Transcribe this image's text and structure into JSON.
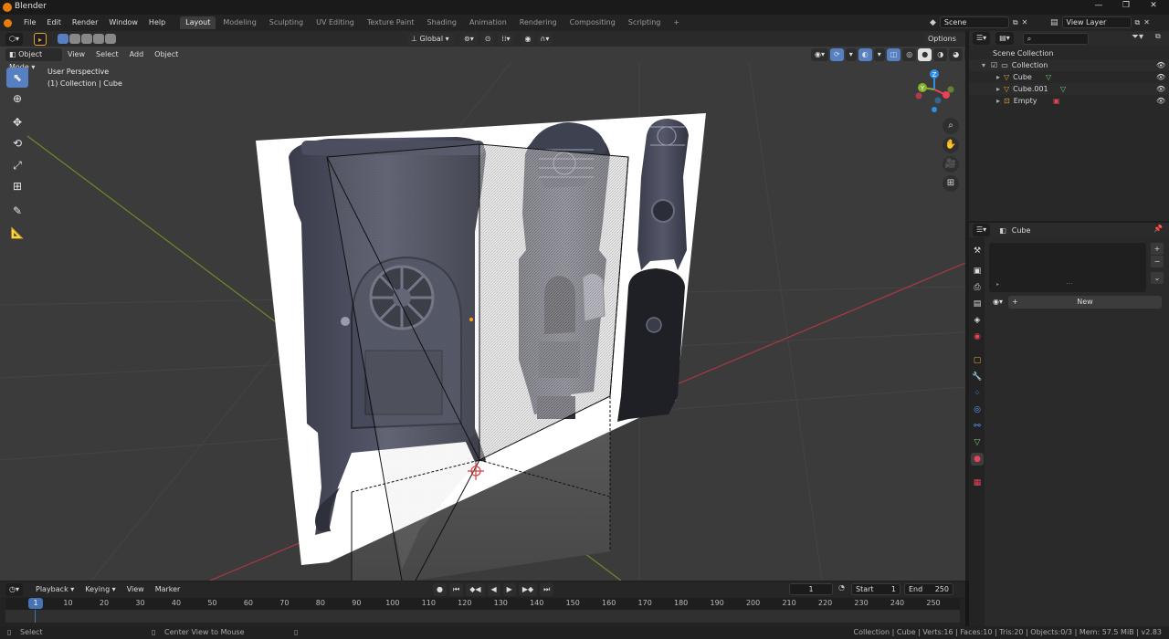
{
  "window": {
    "title": "Blender"
  },
  "menu": {
    "items": [
      "File",
      "Edit",
      "Render",
      "Window",
      "Help"
    ],
    "workspaces": [
      "Layout",
      "Modeling",
      "Sculpting",
      "UV Editing",
      "Texture Paint",
      "Shading",
      "Animation",
      "Rendering",
      "Compositing",
      "Scripting"
    ],
    "add_workspace": "+",
    "scene": "Scene",
    "view_layer": "View Layer"
  },
  "viewport": {
    "mode": "Object Mode",
    "menus": [
      "View",
      "Select",
      "Add",
      "Object"
    ],
    "transform_orientation": "Global",
    "options_label": "Options",
    "overlay_line1": "User Perspective",
    "overlay_line2": "(1) Collection | Cube",
    "gizmo_axes": {
      "x": "X",
      "y": "Y",
      "z": "Z"
    }
  },
  "outliner": {
    "search_placeholder": "",
    "rows": [
      {
        "label": "Scene Collection"
      },
      {
        "label": "Collection"
      },
      {
        "label": "Cube"
      },
      {
        "label": "Cube.001"
      },
      {
        "label": "Empty"
      }
    ]
  },
  "properties": {
    "object_name": "Cube",
    "new_button": "New",
    "add_slot": "+",
    "remove_slot": "−"
  },
  "timeline": {
    "menus": [
      "Playback",
      "Keying",
      "View",
      "Marker"
    ],
    "current_frame": "1",
    "start_label": "Start",
    "start_value": "1",
    "end_label": "End",
    "end_value": "250",
    "ruler_labels": [
      "1",
      "10",
      "20",
      "30",
      "40",
      "50",
      "60",
      "70",
      "80",
      "90",
      "100",
      "110",
      "120",
      "130",
      "140",
      "150",
      "160",
      "170",
      "180",
      "190",
      "200",
      "210",
      "220",
      "230",
      "240",
      "250"
    ]
  },
  "status": {
    "left_hint": "Select",
    "middle_hint": "Center View to Mouse",
    "stats": "Collection | Cube | Verts:16 | Faces:10 | Tris:20 | Objects:0/3 | Mem: 57.5 MiB | v2.83"
  },
  "colors": {
    "accent": "#5680c2",
    "active_frame": "#4772b3",
    "axis_x": "#e84356",
    "axis_y": "#84b22c",
    "axis_z": "#2d8fe8",
    "blender_orange": "#e87d0d"
  }
}
